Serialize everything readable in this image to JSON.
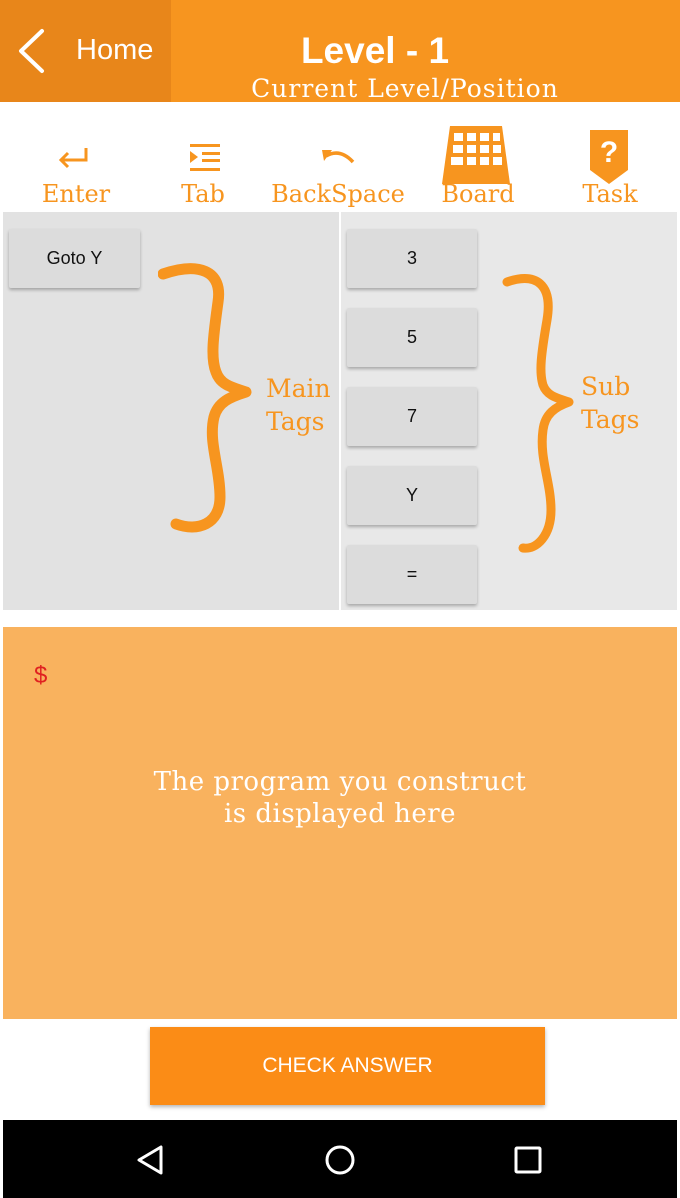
{
  "header": {
    "home_label": "Home",
    "title": "Level - 1",
    "subtitle": "Current Level/Position"
  },
  "toolbar": {
    "items": [
      {
        "label": "Enter",
        "icon": "enter-icon"
      },
      {
        "label": "Tab",
        "icon": "tab-icon"
      },
      {
        "label": "BackSpace",
        "icon": "backspace-icon"
      },
      {
        "label": "Board",
        "icon": "board-grid-icon"
      },
      {
        "label": "Task",
        "icon": "task-question-icon"
      }
    ]
  },
  "main_tags": {
    "buttons": [
      "Goto Y"
    ],
    "annotation_line1": "Main",
    "annotation_line2": "Tags"
  },
  "sub_tags": {
    "buttons": [
      "3",
      "5",
      "7",
      "Y",
      "="
    ],
    "annotation_line1": "Sub",
    "annotation_line2": "Tags"
  },
  "program": {
    "prompt": "$",
    "hint_line1": "The program you construct",
    "hint_line2": "is displayed here"
  },
  "check_answer_label": "CHECK ANSWER",
  "colors": {
    "primary": "#f7951f",
    "home_bg": "#e8861a",
    "program_bg": "#f9b25e",
    "check_button": "#fb8c16",
    "prompt": "#e02020"
  },
  "navbar": {
    "icons": [
      "back-triangle-icon",
      "home-circle-icon",
      "recents-square-icon"
    ]
  }
}
